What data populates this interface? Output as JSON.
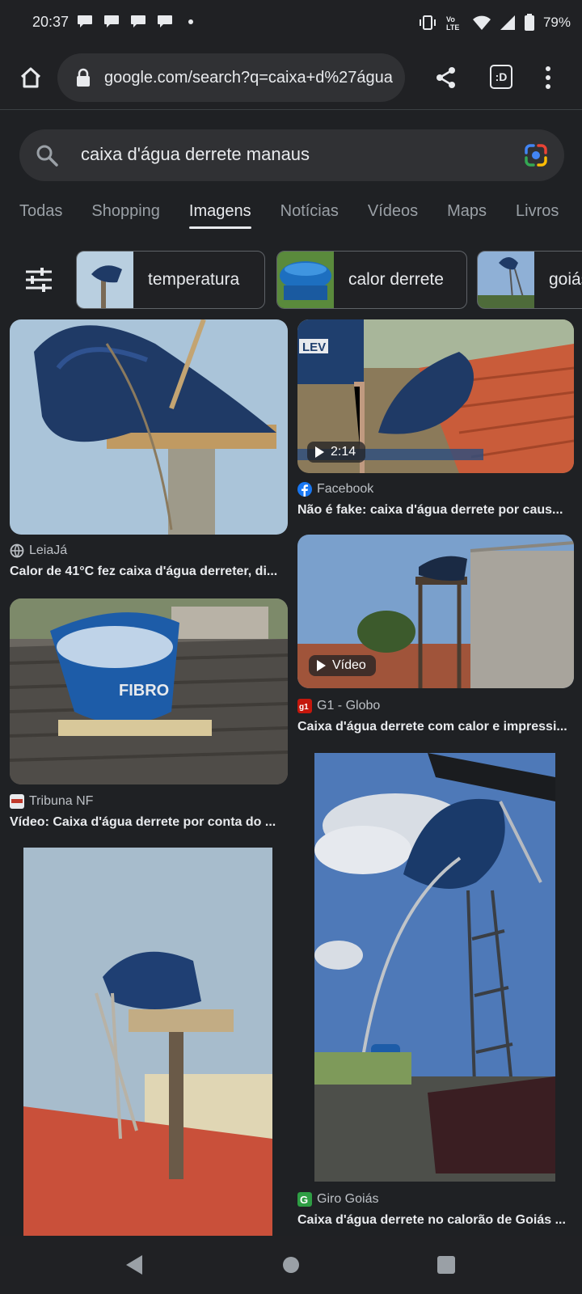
{
  "status_bar": {
    "time": "20:37",
    "network_label": "Vo LTE",
    "battery": "79%"
  },
  "browser": {
    "url": "google.com/search?q=caixa+d%27água",
    "tab_switcher_label": ":D"
  },
  "search": {
    "query": "caixa d'água derrete manaus"
  },
  "tabs": [
    {
      "label": "Todas",
      "active": false
    },
    {
      "label": "Shopping",
      "active": false
    },
    {
      "label": "Imagens",
      "active": true
    },
    {
      "label": "Notícias",
      "active": false
    },
    {
      "label": "Vídeos",
      "active": false
    },
    {
      "label": "Maps",
      "active": false
    },
    {
      "label": "Livros",
      "active": false
    }
  ],
  "chips": [
    {
      "label": "temperatura"
    },
    {
      "label": "calor derrete"
    },
    {
      "label": "goiás"
    }
  ],
  "results": [
    {
      "source": "LeiaJá",
      "title": "Calor de 41°C fez caixa d'água derreter, di..."
    },
    {
      "source": "Facebook",
      "title": "Não é fake: caixa d'água derrete por caus...",
      "duration": "2:14"
    },
    {
      "source": "Tribuna NF",
      "title": "Vídeo: Caixa d'água derrete por conta do ..."
    },
    {
      "source": "G1 - Globo",
      "title": "Caixa d'água derrete com calor e impressi...",
      "badge": "Vídeo"
    },
    {
      "source": "",
      "title": ""
    },
    {
      "source": "Giro Goiás",
      "title": "Caixa d'água derrete no calorão de Goiás ..."
    }
  ],
  "colors": {
    "background": "#1f2124",
    "tank_blue": "#1f3f6e",
    "sky": "#a9c4da"
  }
}
